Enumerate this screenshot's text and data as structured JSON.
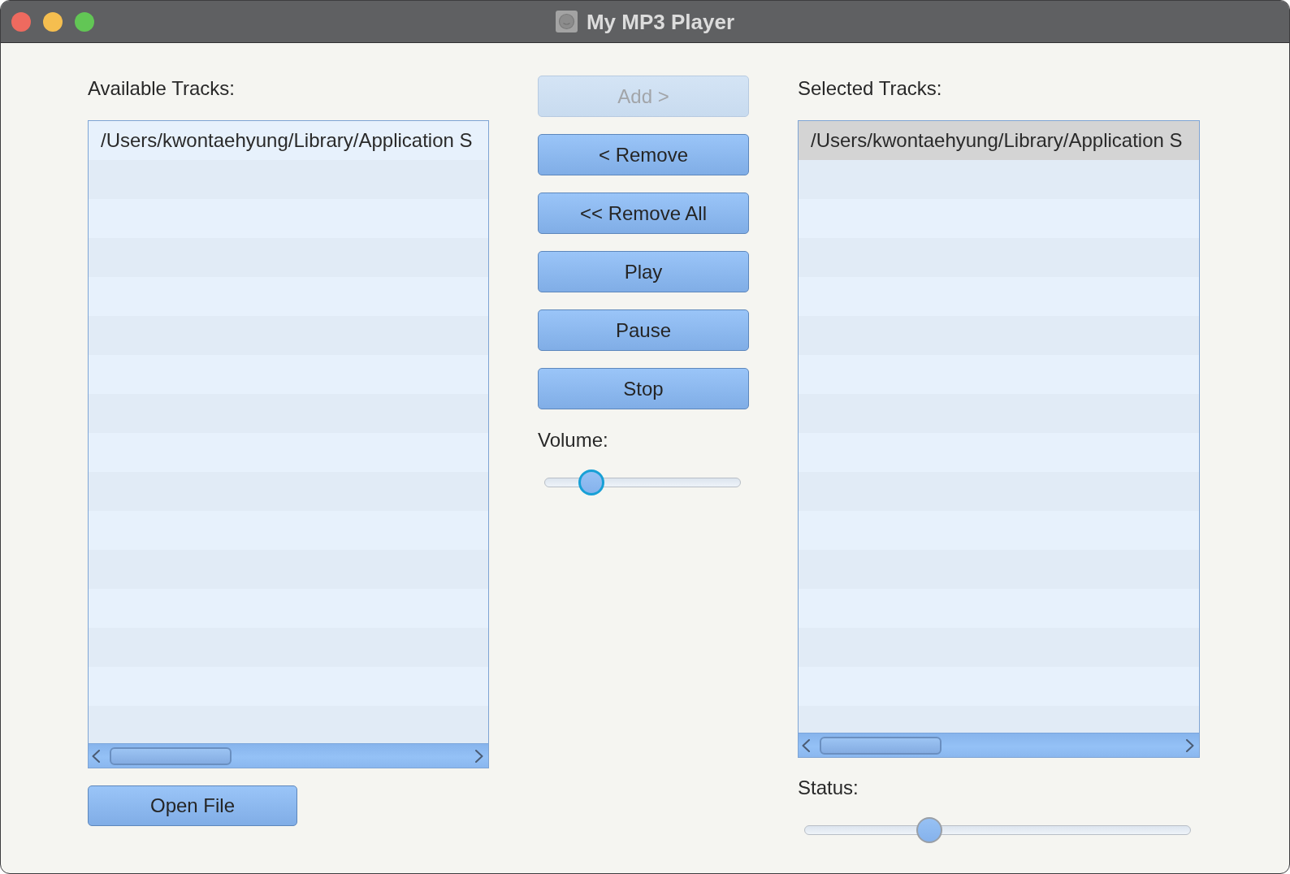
{
  "window": {
    "title": "My MP3 Player"
  },
  "available_tracks": {
    "label": "Available Tracks:",
    "items": [
      {
        "text": "/Users/kwontaehyung/Library/Application S",
        "selected": false
      }
    ]
  },
  "open_file_button": {
    "label": "Open File"
  },
  "controls": {
    "buttons": [
      {
        "label": "Add >",
        "disabled": true
      },
      {
        "label": "< Remove",
        "disabled": false
      },
      {
        "label": "<< Remove All",
        "disabled": false
      },
      {
        "label": "Play",
        "disabled": false
      },
      {
        "label": "Pause",
        "disabled": false
      },
      {
        "label": "Stop",
        "disabled": false
      }
    ],
    "volume": {
      "label": "Volume:",
      "level": 0.2,
      "focused": true
    }
  },
  "selected_tracks": {
    "label": "Selected Tracks:",
    "items": [
      {
        "text": "/Users/kwontaehyung/Library/Application S",
        "selected": true
      }
    ]
  },
  "status": {
    "label": "Status:",
    "level": 0.31,
    "focused": false
  }
}
